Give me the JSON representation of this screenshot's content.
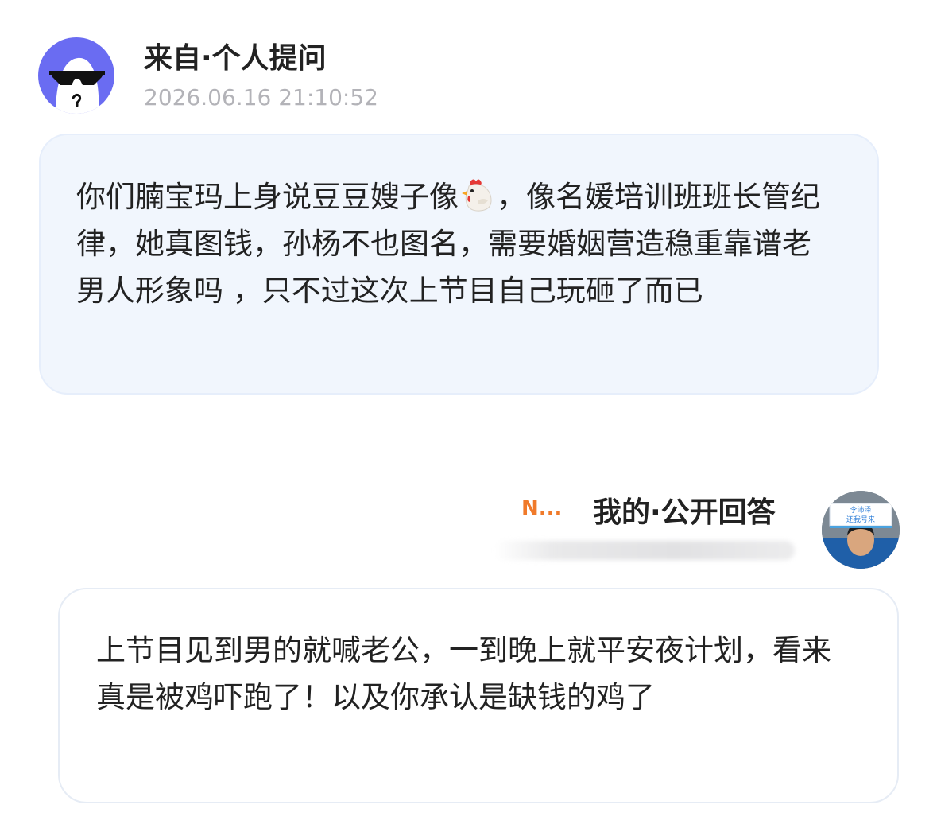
{
  "question": {
    "avatar_icon": "sunglasses-ghost-icon",
    "sender": "来自·个人提问",
    "timestamp": "2026.06.16 21:10:52",
    "text_before_emoji": "你们腩宝玛上身说豆豆嫂子像",
    "emoji": "chicken-emoji-icon",
    "text_after_emoji": "，像名媛培训班班长管纪律，她真图钱，孙杨不也图名，需要婚姻营造稳重靠谱老男人形象吗 ，只不过这次上节目自己玩砸了而已"
  },
  "answer": {
    "tag": "N...",
    "sender": "我的·公开回答",
    "avatar_sign_text_line1": "李沛泽",
    "avatar_sign_text_line2": "还我号来",
    "text": "上节目见到男的就喊老公，一到晚上就平安夜计划，看来真是被鸡吓跑了！以及你承认是缺钱的鸡了"
  },
  "colors": {
    "avatar_bg": "#6a6cf2",
    "question_bubble_bg": "#f1f6fd",
    "tag_orange": "#f07a2a",
    "timestamp_gray": "#b3b3b8"
  }
}
